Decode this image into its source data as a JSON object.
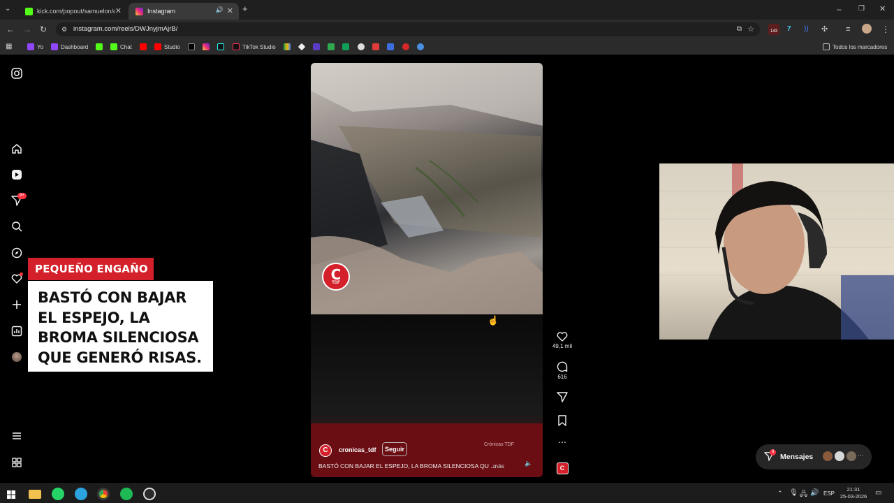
{
  "browser": {
    "tabs": [
      {
        "title": "kick.com/popout/samuelon/ch",
        "active": false
      },
      {
        "title": "Instagram",
        "active": true
      }
    ],
    "url": "instagram.com/reels/DWJnyjmAjrB/",
    "extension_badge": "143",
    "bookmarks": [
      "Yo",
      "Dashboard",
      "Chat",
      "Studio",
      "TikTok Studio"
    ],
    "all_bookmarks_label": "Todos los marcadores"
  },
  "instagram": {
    "sidebar_icons": [
      "instagram-logo-icon",
      "home-icon",
      "reels-icon",
      "direct-icon",
      "search-icon",
      "explore-icon",
      "notifications-icon",
      "create-icon",
      "dashboard-icon",
      "profile-avatar",
      "menu-icon",
      "more-icon"
    ],
    "direct_badge": "9+",
    "reel": {
      "tag": "PEQUEÑO ENGAÑO",
      "headline": "BASTÓ CON BAJAR EL ESPEJO, LA BROMA SILENCIOSA QUE GENERÓ RISAS.",
      "logo_text": "TDF",
      "watermark": "Crónicas TDF",
      "username": "cronicas_tdf",
      "follow_label": "Seguir",
      "caption": "BASTÓ CON BAJAR EL ESPEJO, LA BROMA SILENCIOSA QU ...",
      "more_label": "más"
    },
    "actions": {
      "likes": "49,1 mil",
      "comments": "616"
    },
    "messages": {
      "label": "Mensajes",
      "badge": "8"
    }
  },
  "taskbar": {
    "language": "ESP",
    "time": "21:31",
    "date": "25-03-2026"
  }
}
